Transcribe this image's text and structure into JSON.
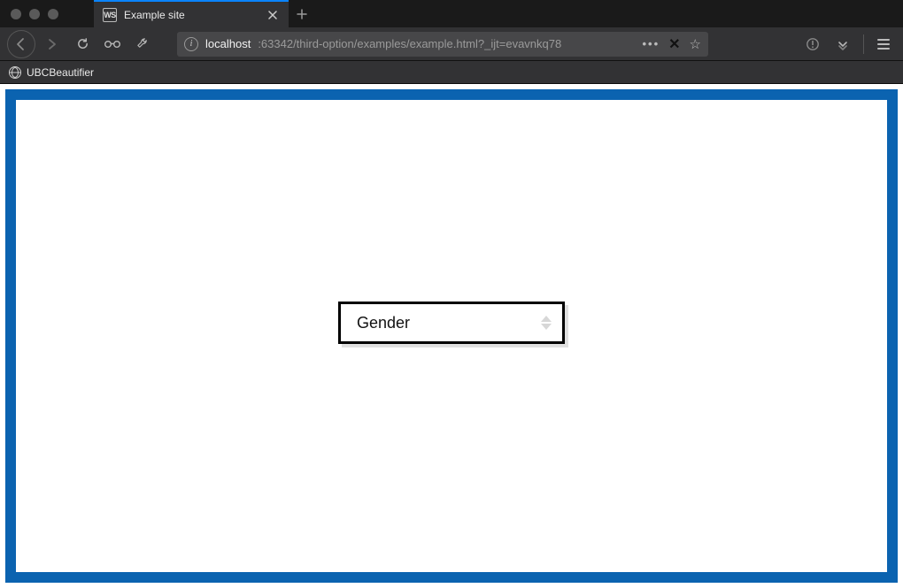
{
  "window": {
    "tab": {
      "favicon_text": "WS",
      "title": "Example site"
    }
  },
  "toolbar": {
    "url": {
      "host": "localhost",
      "path": ":63342/third-option/examples/example.html?_ijt=evavnkq78"
    }
  },
  "bookmarks": {
    "items": [
      {
        "label": "UBCBeautifier"
      }
    ]
  },
  "page": {
    "select": {
      "value": "Gender"
    }
  }
}
